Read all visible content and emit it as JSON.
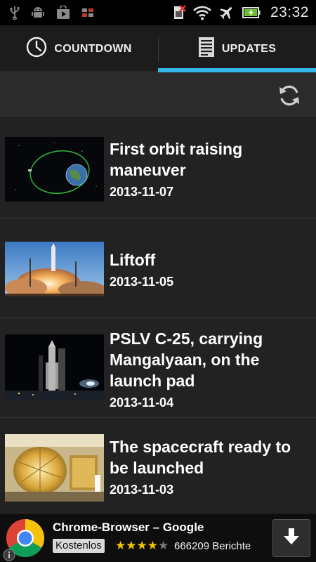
{
  "status_bar": {
    "time": "23:32",
    "left_icons": [
      "usb-icon",
      "android-debug-icon",
      "play-store-icon",
      "app-notification-icon"
    ],
    "right_icons": [
      "no-sim-icon",
      "wifi-icon",
      "airplane-mode-icon",
      "battery-icon"
    ]
  },
  "tabs": [
    {
      "label": "COUNTDOWN",
      "icon": "clock-icon",
      "active": false
    },
    {
      "label": "UPDATES",
      "icon": "document-icon",
      "active": true
    }
  ],
  "toolbar": {
    "refresh_icon": "refresh-icon"
  },
  "updates": [
    {
      "title": "First orbit raising maneuver",
      "date": "2013-11-07",
      "thumb": "orbit-image"
    },
    {
      "title": "Liftoff",
      "date": "2013-11-05",
      "thumb": "liftoff-image"
    },
    {
      "title": "PSLV C-25, carrying Mangalyaan, on the launch pad",
      "date": "2013-11-04",
      "thumb": "launch-pad-image"
    },
    {
      "title": "The spacecraft ready to be launched",
      "date": "2013-11-03",
      "thumb": "spacecraft-image"
    }
  ],
  "ad": {
    "title": "Chrome-Browser – Google",
    "badge": "Kostenlos",
    "rating": 4,
    "rating_max": 5,
    "reviews": "666209 Berichte",
    "logo": "chrome-logo-icon",
    "download_icon": "download-icon"
  },
  "colors": {
    "accent": "#33b5e5",
    "background": "#222222",
    "tab_bar": "#1c1c1c",
    "toolbar": "#2b2b2b",
    "star": "#f2c200"
  }
}
